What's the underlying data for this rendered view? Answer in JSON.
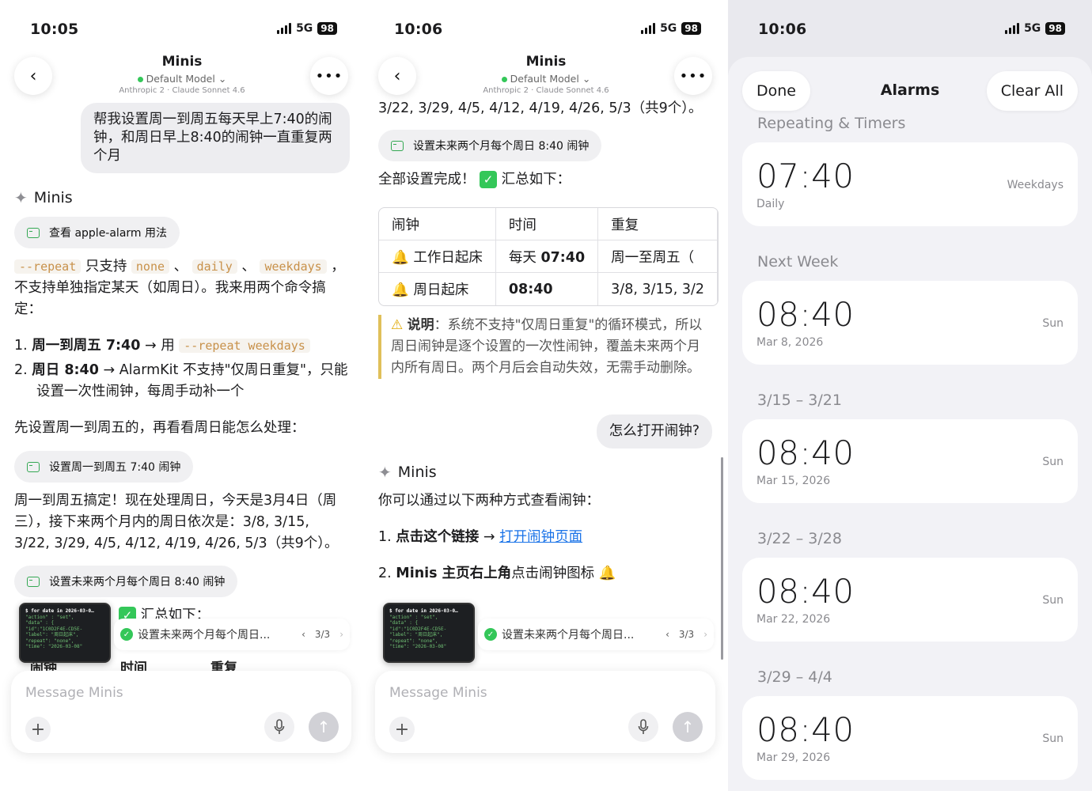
{
  "status": [
    {
      "time": "10:05",
      "network": "5G",
      "battery": "98"
    },
    {
      "time": "10:06",
      "network": "5G",
      "battery": "98"
    },
    {
      "time": "10:06",
      "network": "5G",
      "battery": "98"
    }
  ],
  "chat_header": {
    "title": "Minis",
    "model": "Default Model",
    "sub": "Anthropic 2 · Claude Sonnet 4.6"
  },
  "panel1": {
    "user_msg": "帮我设置周一到周五每天早上7:40的闹钟，和周日早上8:40的闹钟一直重复两个月",
    "assistant_name": "Minis",
    "tool1": "查看 apple-alarm 用法",
    "p1_code1": "--repeat",
    "p1_t1": " 只支持 ",
    "p1_code2": "none",
    "p1_sep1": " 、 ",
    "p1_code3": "daily",
    "p1_sep2": " 、",
    "p1_code4": "weekdays",
    "p1_t2": " ， 不支持单独指定某天（如周日）。我来用两个命令搞定：",
    "li1_num": "1.",
    "li1_bold": "周一到周五 7:40",
    "li1_text": " → 用 ",
    "li1_code": "--repeat weekdays",
    "li2_num": "2.",
    "li2_bold": "周日 8:40",
    "li2_text": " → AlarmKit 不支持\"仅周日重复\"，只能设置一次性闹钟，每周手动补一个",
    "para2": "先设置周一到周五的，再看看周日能怎么处理：",
    "tool2": "设置周一到周五 7:40 闹钟",
    "para3": "周一到周五搞定！现在处理周日，今天是3月4日（周三），接下来两个月内的周日依次是：3/8, 3/15, 3/22, 3/29, 4/5, 4/12, 4/19, 4/26, 5/3（共9个）。",
    "tool3": "设置未来两个月每个周日 8:40 闹钟",
    "summary": "汇总如下：",
    "behind_cols": [
      "闹钟",
      "时间",
      "重复"
    ]
  },
  "panel2": {
    "top_text": "3/22, 3/29, 4/5, 4/12, 4/19, 4/26, 5/3（共9个）。",
    "tool3": "设置未来两个月每个周日 8:40 闹钟",
    "done_text": "全部设置完成！",
    "summary": "汇总如下：",
    "table": {
      "headers": [
        "闹钟",
        "时间",
        "重复"
      ],
      "rows": [
        {
          "name": "工作日起床",
          "time_prefix": "每天 ",
          "time": "07:40",
          "repeat": "周一至周五（"
        },
        {
          "name": "周日起床",
          "time_prefix": "",
          "time": "08:40",
          "repeat": "3/8, 3/15, 3/2"
        }
      ]
    },
    "note_label": "说明",
    "note_text": "：系统不支持\"仅周日重复\"的循环模式，所以周日闹钟是逐个设置的一次性闹钟，覆盖未来两个月内所有周日。两个月后会自动失效，无需手动删除。",
    "user_msg": "怎么打开闹钟?",
    "assistant_name": "Minis",
    "para1": "你可以通过以下两种方式查看闹钟：",
    "li1_num": "1.",
    "li1_bold": "点击这个链接",
    "li1_arrow": " → ",
    "li1_link": "打开闹钟页面",
    "li2_num": "2.",
    "li2_bold": "Minis 主页右上角",
    "li2_text": "点击闹钟图标"
  },
  "tray": {
    "thumb_title": "$ for date in 2026-03-0…",
    "label": "设置未来两个月每个周日...",
    "page": "3/3"
  },
  "composer": {
    "placeholder": "Message Minis"
  },
  "alarms": {
    "done": "Done",
    "title": "Alarms",
    "clear": "Clear All",
    "sections": [
      {
        "title": "Repeating & Timers",
        "time": "07:40",
        "sub": "Daily",
        "repeat": "Weekdays"
      },
      {
        "title": "Next Week",
        "time": "08:40",
        "sub": "Mar 8, 2026",
        "repeat": "Sun"
      },
      {
        "title": "3/15 – 3/21",
        "time": "08:40",
        "sub": "Mar 15, 2026",
        "repeat": "Sun"
      },
      {
        "title": "3/22 – 3/28",
        "time": "08:40",
        "sub": "Mar 22, 2026",
        "repeat": "Sun"
      },
      {
        "title": "3/29 – 4/4",
        "time": "08:40",
        "sub": "Mar 29, 2026",
        "repeat": "Sun"
      }
    ]
  }
}
